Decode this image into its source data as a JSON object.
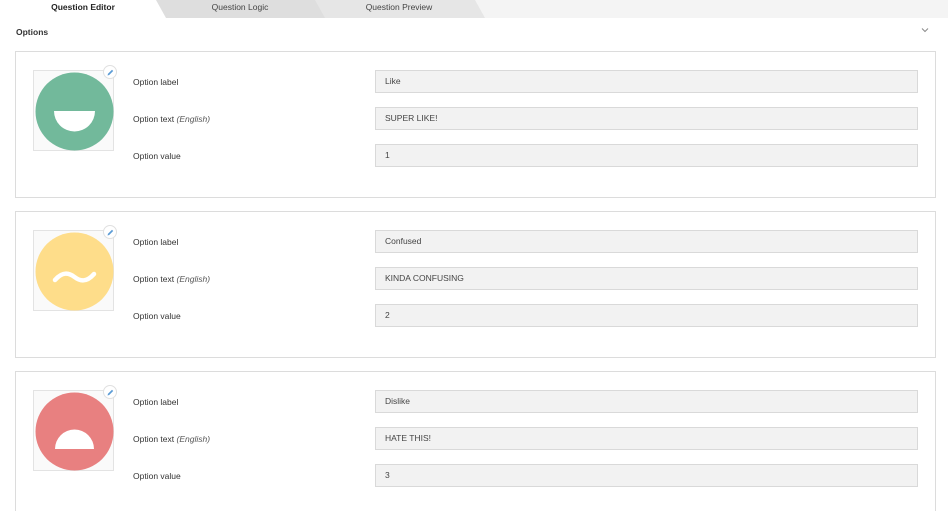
{
  "tabs": [
    {
      "label": "Question Editor"
    },
    {
      "label": "Question Logic"
    },
    {
      "label": "Question Preview"
    }
  ],
  "section": {
    "title": "Options"
  },
  "labels": {
    "option_label": "Option label",
    "option_text": "Option text",
    "option_text_lang": "(English)",
    "option_value": "Option value"
  },
  "options": [
    {
      "label": "Like",
      "text": "SUPER LIKE!",
      "value": "1",
      "face_color": "#72b99b",
      "face_icon": "smile-face-icon"
    },
    {
      "label": "Confused",
      "text": "KINDA CONFUSING",
      "value": "2",
      "face_color": "#fedd8a",
      "face_icon": "confused-face-icon"
    },
    {
      "label": "Dislike",
      "text": "HATE THIS!",
      "value": "3",
      "face_color": "#e88080",
      "face_icon": "sad-face-icon"
    }
  ]
}
